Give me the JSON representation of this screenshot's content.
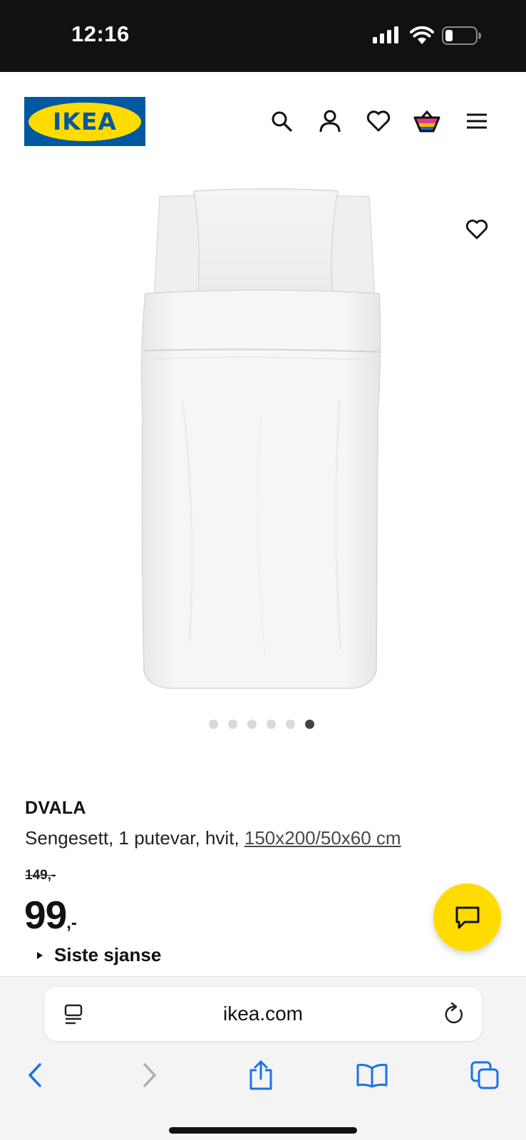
{
  "status_bar": {
    "time": "12:16",
    "icons": [
      "signal-icon",
      "wifi-icon",
      "battery-icon"
    ]
  },
  "header": {
    "logo_text": "IKEA",
    "icons": [
      "search-icon",
      "account-icon",
      "heart-icon",
      "cart-icon",
      "menu-icon"
    ],
    "colors": {
      "logo_blue": "#0058a3",
      "logo_yellow": "#ffdb00"
    }
  },
  "gallery": {
    "image_count": 6,
    "active_index": 6
  },
  "product": {
    "name": "DVALA",
    "description": "Sengesett, 1 putevar, hvit, ",
    "size": "150x200/50x60 cm",
    "old_price": "149,-",
    "price": "99",
    "price_suffix": ",-",
    "last_chance": "Siste sjanse"
  },
  "chat": {
    "icon": "chat-icon",
    "color": "#ffdb00"
  },
  "browser": {
    "url": "ikea.com",
    "nav_icons": [
      "back-icon",
      "forward-icon",
      "share-icon",
      "bookmarks-icon",
      "tabs-icon"
    ]
  }
}
